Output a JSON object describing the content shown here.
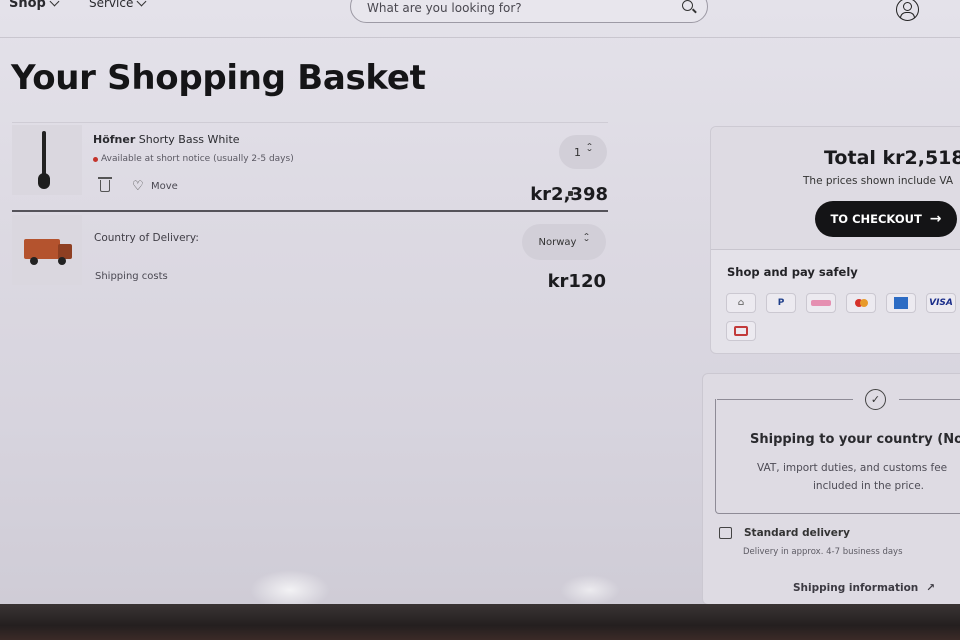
{
  "nav": {
    "shop_label": "Shop",
    "service_label": "Service",
    "search_placeholder": "What are you looking for?"
  },
  "page": {
    "title": "Your Shopping Basket"
  },
  "basket": {
    "item": {
      "brand": "Höfner",
      "name": " Shorty Bass White",
      "availability": "Available at short notice (usually 2-5 days)",
      "move_label": "Move",
      "quantity": "1",
      "price": "kr2,398"
    },
    "delivery": {
      "country_label": "Country of Delivery:",
      "country_value": "Norway",
      "shipping_label": "Shipping costs",
      "shipping_price": "kr120"
    }
  },
  "summary": {
    "total": "Total kr2,518",
    "vat_note": "The prices shown include VA",
    "checkout_label": "TO CHECKOUT",
    "pay_title": "Shop and pay safely",
    "payment_methods": [
      "Bank",
      "P",
      "Klarna",
      "Mastercard",
      "Amex",
      "VISA",
      "JCB"
    ]
  },
  "shipping": {
    "title": "Shipping to your country (Nor",
    "desc_line1": "VAT, import duties, and customs fee",
    "desc_line2": "included in the price.",
    "standard_title": "Standard delivery",
    "standard_sub": "Delivery in approx. 4-7 business days",
    "info_link": "Shipping information"
  },
  "colors": {
    "checkout_bg": "#141416",
    "availability_dot": "#c4342b"
  }
}
